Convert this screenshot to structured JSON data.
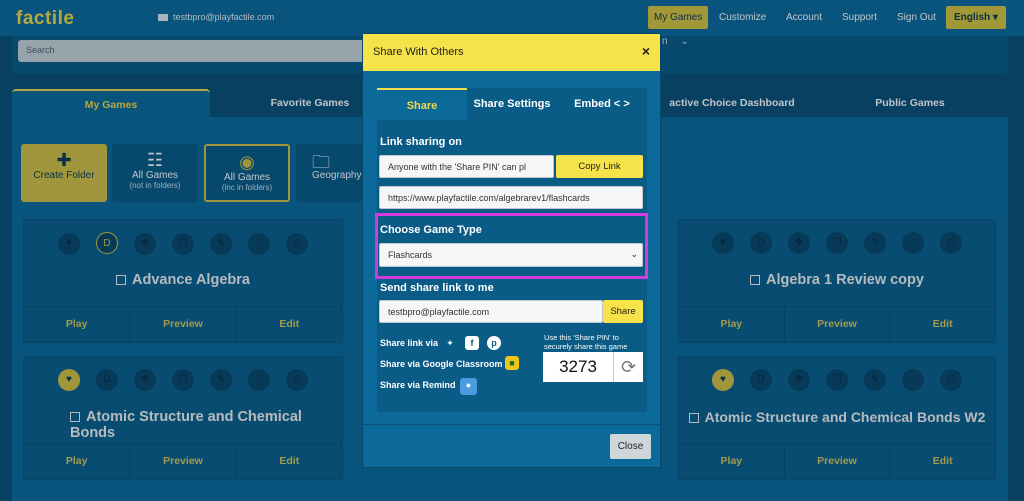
{
  "nav": {
    "logo": "factile",
    "email": "testbpro@playfactile.com",
    "my_games": "My Games",
    "customize": "Customize",
    "account": "Account",
    "support": "Support",
    "sign_out": "Sign Out",
    "language": "English"
  },
  "search": {
    "placeholder": "Search",
    "sort_fragment": "n"
  },
  "tabs": {
    "my_games": "My Games",
    "favorite_games": "Favorite Games",
    "active_choice": "active Choice Dashboard",
    "public_games": "Public Games"
  },
  "folders": {
    "create": "Create Folder",
    "all_games": "All Games",
    "all_games_sub": "(not in folders)",
    "all_games_inc": "All Games",
    "all_games_inc_sub": "(inc in folders)",
    "geography": "Geography"
  },
  "cards": [
    {
      "title": "Advance Algebra",
      "play": "Play",
      "preview": "Preview",
      "edit": "Edit"
    },
    {
      "title": "Algebra 1 Review copy",
      "play": "Play",
      "preview": "Preview",
      "edit": "Edit"
    },
    {
      "title": "Atomic Structure and Chemical Bonds",
      "play": "Play",
      "preview": "Preview",
      "edit": "Edit"
    },
    {
      "title": "Atomic Structure and Chemical Bonds W2",
      "play": "Play",
      "preview": "Preview",
      "edit": "Edit"
    }
  ],
  "card_icons": {
    "heart": "♥",
    "difficulty": "D",
    "trophy": "❖",
    "copy": "❐",
    "edit": "✎",
    "share": "∴",
    "print": "⎙"
  },
  "modal": {
    "title": "Share With Others",
    "close_x": "×",
    "tab_share": "Share",
    "tab_settings": "Share Settings",
    "tab_embed": "Embed < >",
    "link_sharing_label": "Link sharing on",
    "link_sharing_value": "Anyone with the 'Share PIN' can pl",
    "copy_link": "Copy Link",
    "link_url": "https://www.playfactile.com/algebrarev1/flashcards",
    "game_type_label": "Choose Game Type",
    "game_type_value": "Flashcards",
    "send_label": "Send share link to me",
    "send_email": "testbpro@playfactile.com",
    "share_btn": "Share",
    "share_link_via": "Share link via",
    "google_classroom": "Share via Google Classroom",
    "remind": "Share via Remind",
    "pin_note": "Use this 'Share PIN' to securely share this game",
    "pin": "3273",
    "close_btn": "Close"
  },
  "colors": {
    "accent": "#f6e34a",
    "highlight": "#d23be0",
    "panel": "#0b6a9a"
  }
}
